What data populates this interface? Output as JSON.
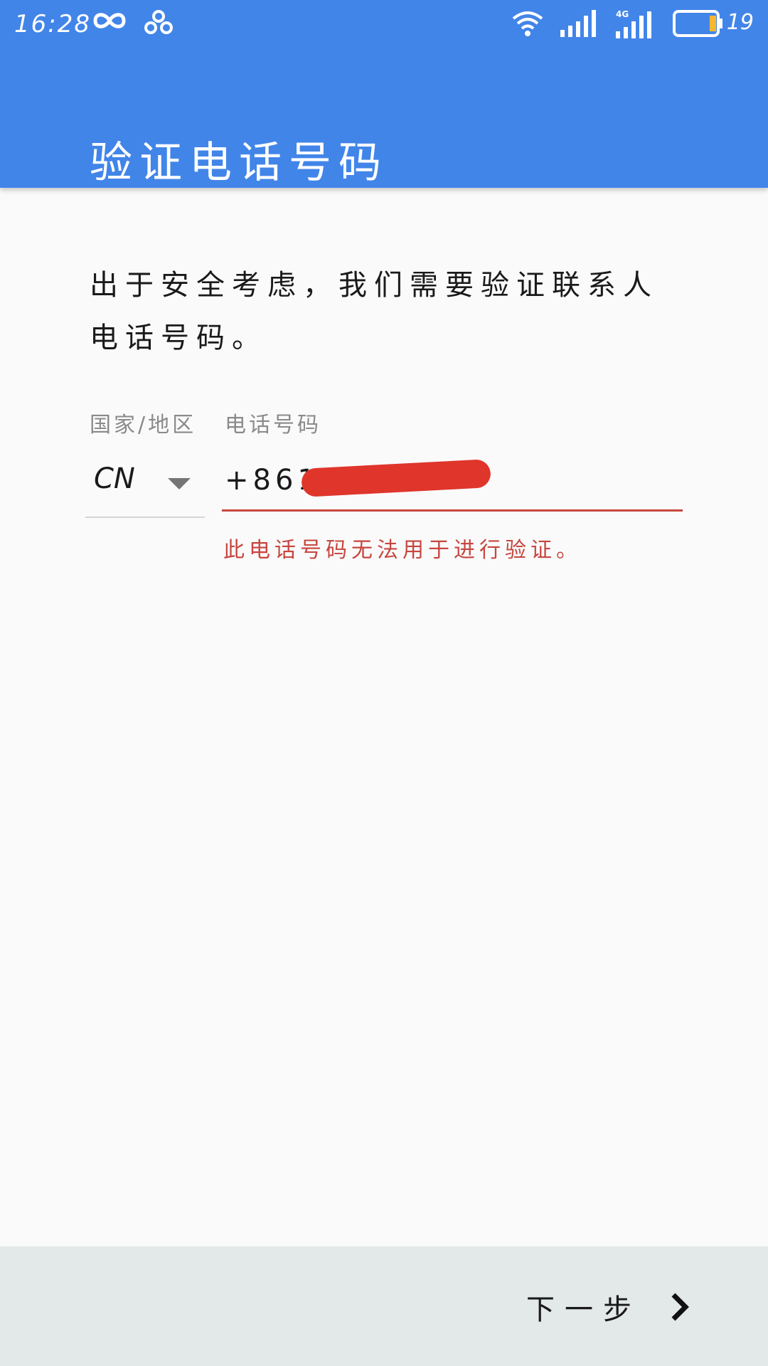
{
  "status_bar": {
    "time": "16:28",
    "battery_level": "19",
    "network_label": "4G",
    "icons": [
      "infinity-icon",
      "cloud-sync-icon",
      "wifi-icon",
      "signal-icon",
      "signal-4g-icon",
      "battery-icon"
    ],
    "battery_accent_color": "#f5b82e"
  },
  "app_bar": {
    "title": "验证电话号码",
    "color": "#4285e9"
  },
  "content": {
    "description": "出于安全考虑，我们需要验证联系人电话号码。",
    "country_label": "国家/地区",
    "phone_label": "电话号码",
    "country_value": "CN",
    "phone_value": "+8617",
    "error_message": "此电话号码无法用于进行验证。",
    "error_color": "#c7463f"
  },
  "footer": {
    "next_label": "下一步"
  }
}
